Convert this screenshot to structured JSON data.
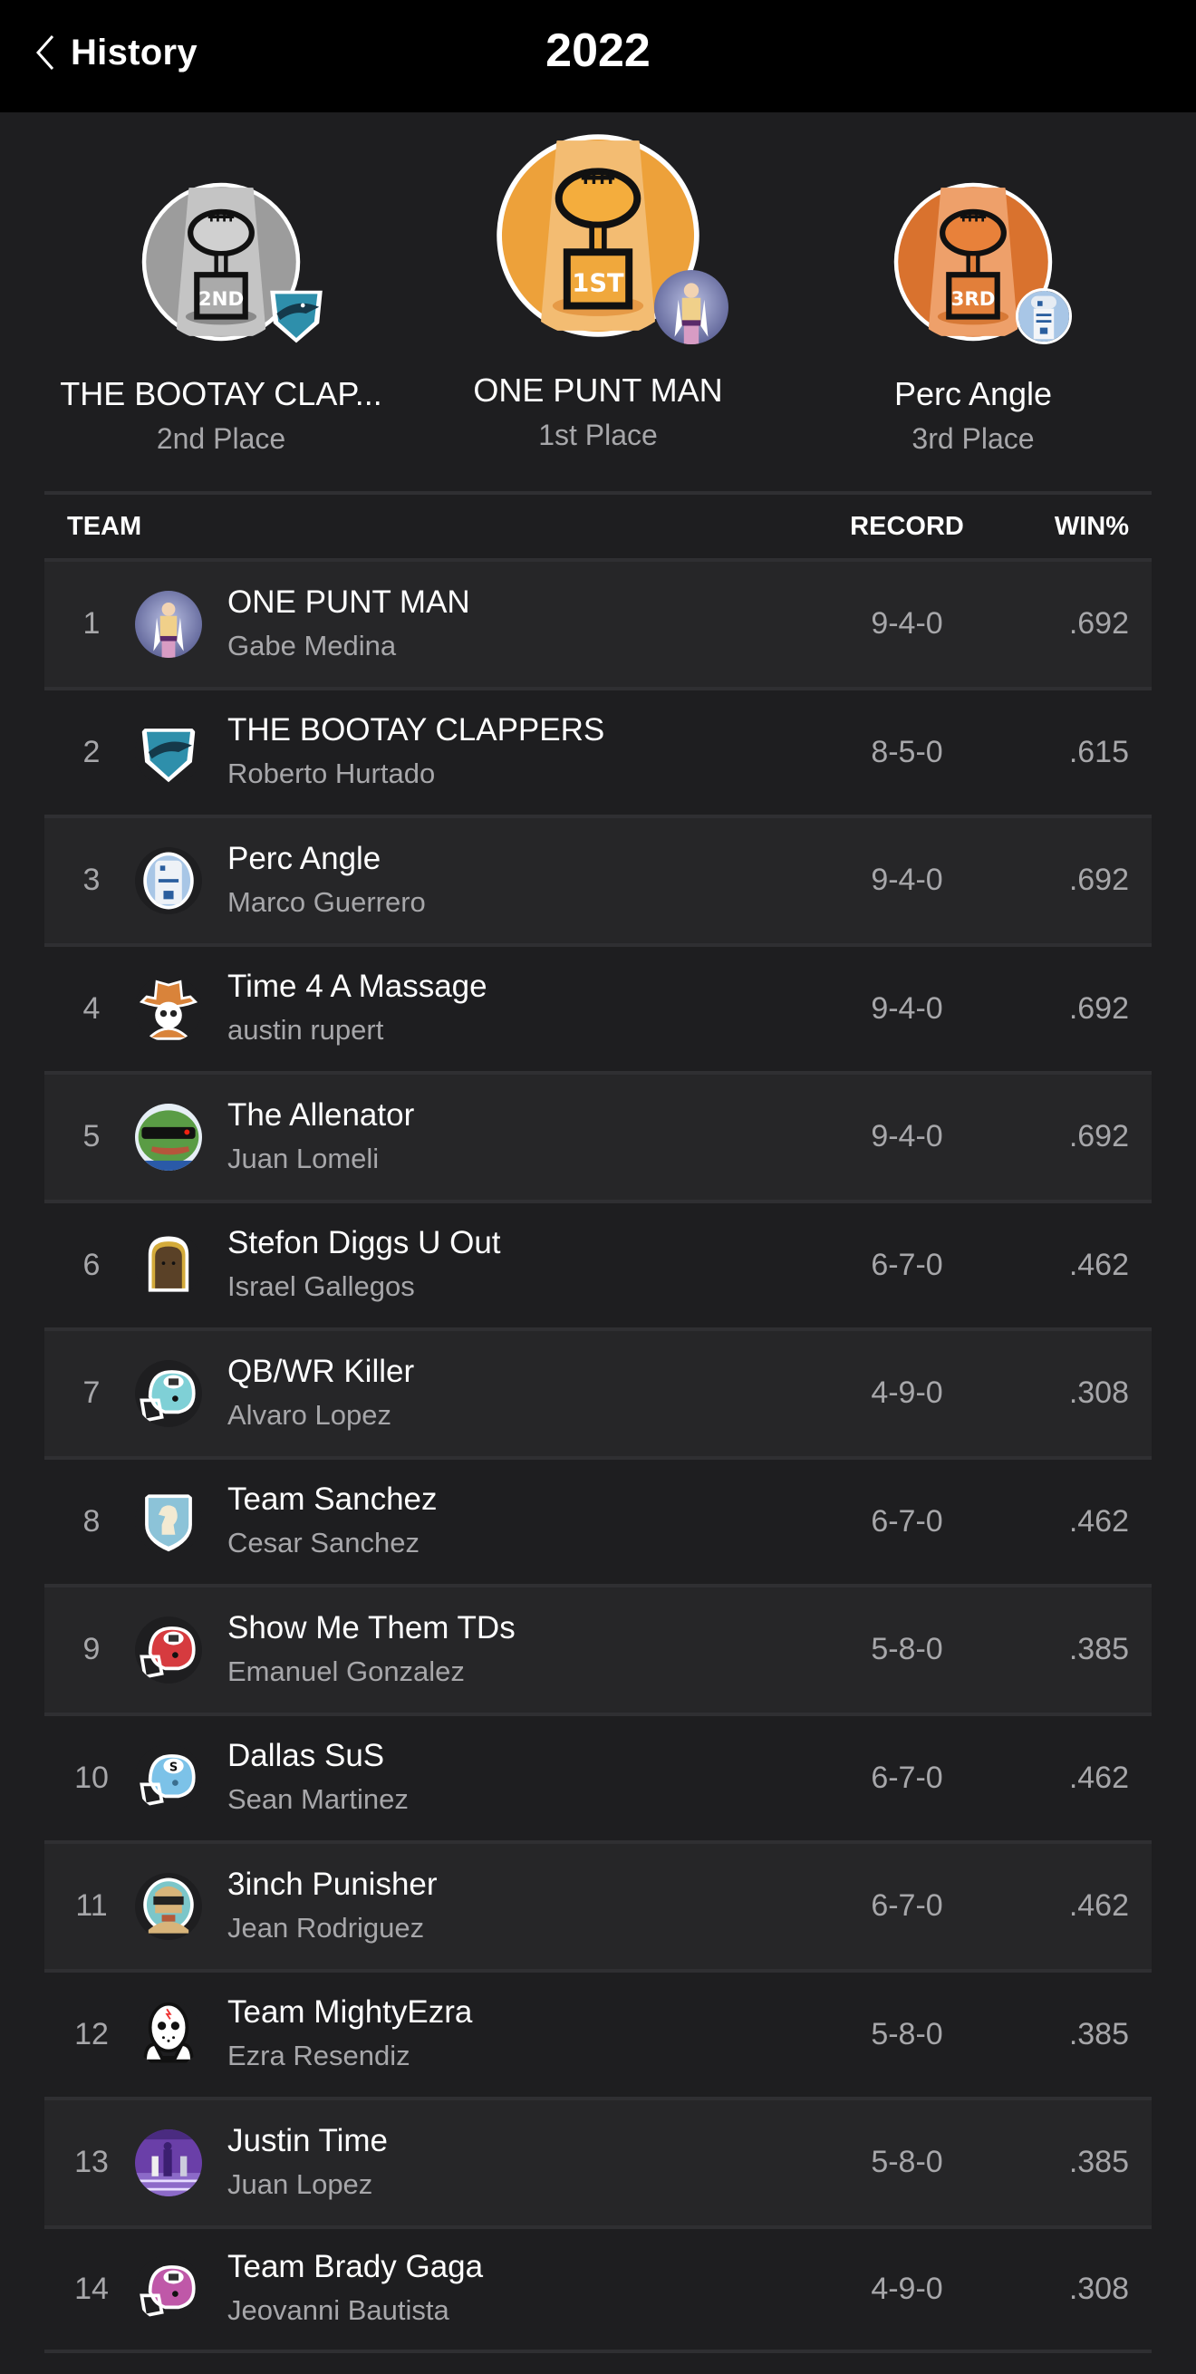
{
  "header": {
    "back_label": "History",
    "title": "2022"
  },
  "podium": [
    {
      "position": "2nd",
      "team": "THE BOOTAY CLAP...",
      "place_label": "2nd Place",
      "trophy_color": "#b8b8b8",
      "badge_text": "2ND",
      "avatar_icon": "shark-shield-icon"
    },
    {
      "position": "1st",
      "team": "ONE PUNT MAN",
      "place_label": "1st Place",
      "trophy_color": "#f0a93a",
      "badge_text": "1ST",
      "avatar_icon": "anime-hero-avatar"
    },
    {
      "position": "3rd",
      "team": "Perc Angle",
      "place_label": "3rd Place",
      "trophy_color": "#e07c35",
      "badge_text": "3RD",
      "avatar_icon": "robot-droid-avatar"
    }
  ],
  "table": {
    "headers": {
      "team": "TEAM",
      "record": "RECORD",
      "win_pct": "WIN%"
    },
    "rows": [
      {
        "rank": "1",
        "team": "ONE PUNT MAN",
        "owner": "Gabe Medina",
        "record": "9-4-0",
        "win_pct": ".692",
        "avatar_icon": "anime-hero-avatar"
      },
      {
        "rank": "2",
        "team": "THE BOOTAY CLAPPERS",
        "owner": "Roberto Hurtado",
        "record": "8-5-0",
        "win_pct": ".615",
        "avatar_icon": "shark-shield-icon"
      },
      {
        "rank": "3",
        "team": "Perc Angle",
        "owner": "Marco Guerrero",
        "record": "9-4-0",
        "win_pct": ".692",
        "avatar_icon": "robot-droid-avatar"
      },
      {
        "rank": "4",
        "team": "Time 4 A Massage",
        "owner": "austin rupert",
        "record": "9-4-0",
        "win_pct": ".692",
        "avatar_icon": "cowboy-skull-icon"
      },
      {
        "rank": "5",
        "team": "The Allenator",
        "owner": "Juan Lomeli",
        "record": "9-4-0",
        "win_pct": ".692",
        "avatar_icon": "frog-sunglasses-avatar"
      },
      {
        "rank": "6",
        "team": "Stefon Diggs U Out",
        "owner": "Israel Gallegos",
        "record": "6-7-0",
        "win_pct": ".462",
        "avatar_icon": "wookiee-avatar"
      },
      {
        "rank": "7",
        "team": "QB/WR Killer",
        "owner": "Alvaro Lopez",
        "record": "4-9-0",
        "win_pct": ".308",
        "avatar_icon": "helmet-teal-icon"
      },
      {
        "rank": "8",
        "team": "Team Sanchez",
        "owner": "Cesar Sanchez",
        "record": "6-7-0",
        "win_pct": ".462",
        "avatar_icon": "knight-shield-icon"
      },
      {
        "rank": "9",
        "team": "Show Me Them TDs",
        "owner": "Emanuel Gonzalez",
        "record": "5-8-0",
        "win_pct": ".385",
        "avatar_icon": "helmet-red-icon"
      },
      {
        "rank": "10",
        "team": "Dallas SuS",
        "owner": "Sean Martinez",
        "record": "6-7-0",
        "win_pct": ".462",
        "avatar_icon": "helmet-blue-s-icon"
      },
      {
        "rank": "11",
        "team": "3inch Punisher",
        "owner": "Jean Rodriguez",
        "record": "6-7-0",
        "win_pct": ".462",
        "avatar_icon": "visor-soldier-avatar"
      },
      {
        "rank": "12",
        "team": "Team MightyEzra",
        "owner": "Ezra Resendiz",
        "record": "5-8-0",
        "win_pct": ".385",
        "avatar_icon": "hockey-mask-icon"
      },
      {
        "rank": "13",
        "team": "Justin Time",
        "owner": "Juan Lopez",
        "record": "5-8-0",
        "win_pct": ".385",
        "avatar_icon": "football-field-photo-avatar"
      },
      {
        "rank": "14",
        "team": "Team Brady Gaga",
        "owner": "Jeovanni Bautista",
        "record": "4-9-0",
        "win_pct": ".308",
        "avatar_icon": "helmet-pink-icon"
      }
    ]
  },
  "colors": {
    "header_bg": "#000000",
    "page_bg": "#1e1e20",
    "row_alt_bg": "#262628",
    "divider": "#2f2f32",
    "secondary_text": "#a7a7aa"
  }
}
